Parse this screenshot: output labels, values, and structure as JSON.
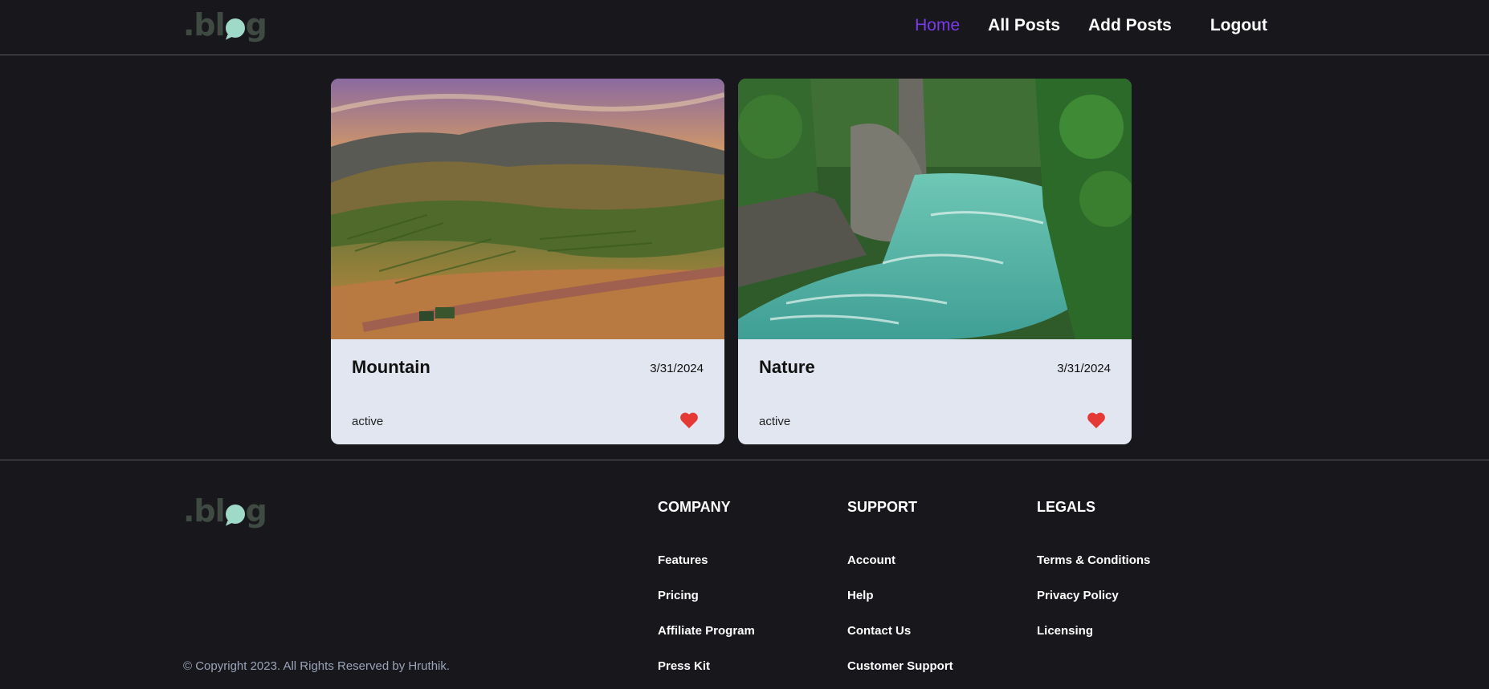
{
  "header": {
    "logo_text": ".blog",
    "nav": [
      {
        "label": "Home",
        "active": true
      },
      {
        "label": "All Posts",
        "active": false
      },
      {
        "label": "Add Posts",
        "active": false
      },
      {
        "label": "Logout",
        "active": false
      }
    ]
  },
  "posts": [
    {
      "title": "Mountain",
      "date": "3/31/2024",
      "status": "active",
      "liked": true
    },
    {
      "title": "Nature",
      "date": "3/31/2024",
      "status": "active",
      "liked": true
    }
  ],
  "footer": {
    "logo_text": ".blog",
    "columns": [
      {
        "heading": "COMPANY",
        "links": [
          "Features",
          "Pricing",
          "Affiliate Program",
          "Press Kit"
        ]
      },
      {
        "heading": "SUPPORT",
        "links": [
          "Account",
          "Help",
          "Contact Us",
          "Customer Support"
        ]
      },
      {
        "heading": "LEGALS",
        "links": [
          "Terms & Conditions",
          "Privacy Policy",
          "Licensing"
        ]
      }
    ],
    "copyright": "© Copyright 2023. All Rights Reserved by Hruthik."
  },
  "colors": {
    "background": "#18181c",
    "accent": "#7c3aed",
    "card_body": "#e2e6f0",
    "heart": "#e53935",
    "logo_dark": "#3f4a42",
    "logo_bubble": "#9fd9c8"
  }
}
